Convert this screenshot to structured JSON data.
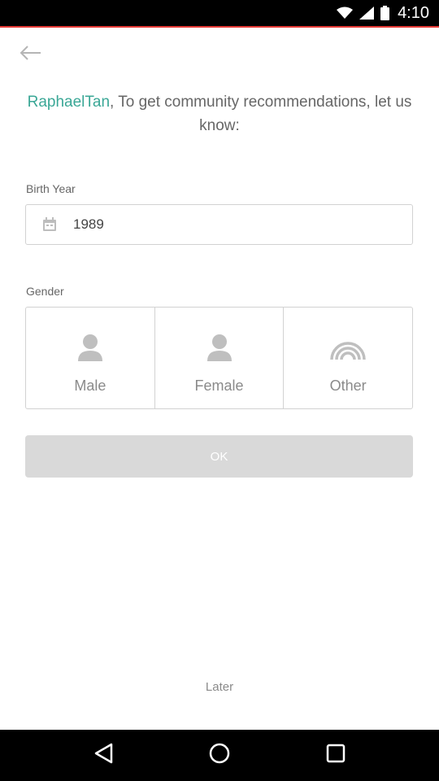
{
  "status_bar": {
    "time": "4:10"
  },
  "header": {
    "back_icon": "arrow-left-icon"
  },
  "intro": {
    "username": "RaphaelTan",
    "message": ", To get community recommendations, let us know:"
  },
  "birth_year": {
    "label": "Birth Year",
    "value": "1989",
    "icon": "calendar-icon"
  },
  "gender": {
    "label": "Gender",
    "options": [
      {
        "label": "Male",
        "icon": "person-icon"
      },
      {
        "label": "Female",
        "icon": "person-icon"
      },
      {
        "label": "Other",
        "icon": "signal-arcs-icon"
      }
    ]
  },
  "ok_button": {
    "label": "OK"
  },
  "later_link": {
    "label": "Later"
  },
  "colors": {
    "accent": "#3aa796",
    "status_accent": "#e53935",
    "button_disabled": "#d9d9d9"
  }
}
